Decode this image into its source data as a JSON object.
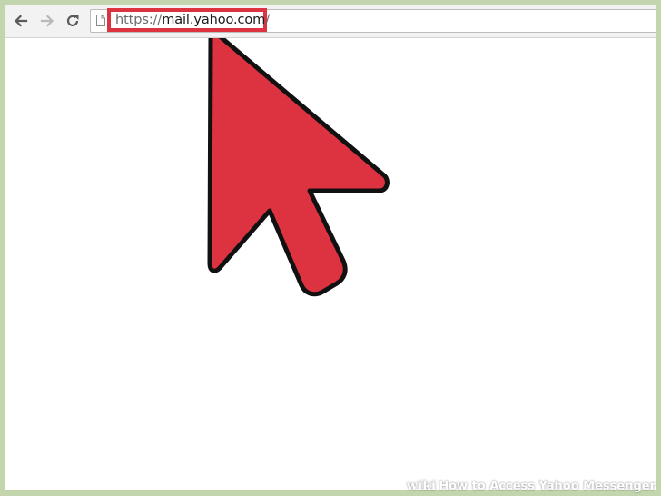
{
  "browser": {
    "back_icon": "back-arrow-icon",
    "forward_icon": "forward-arrow-icon",
    "reload_icon": "reload-icon",
    "page_icon": "page-icon",
    "url": {
      "scheme": "https://",
      "host": "mail.yahoo.com",
      "path": "/"
    },
    "highlight_color": "#dd3240"
  },
  "annotation": {
    "cursor_icon": "pointer-arrow-icon",
    "cursor_color": "#dd3240"
  },
  "watermark": {
    "logo": "wiki",
    "title": "How to Access Yahoo Messenger"
  },
  "colors": {
    "frame": "#c3d5ad",
    "toolbar": "#f2f2f2"
  }
}
